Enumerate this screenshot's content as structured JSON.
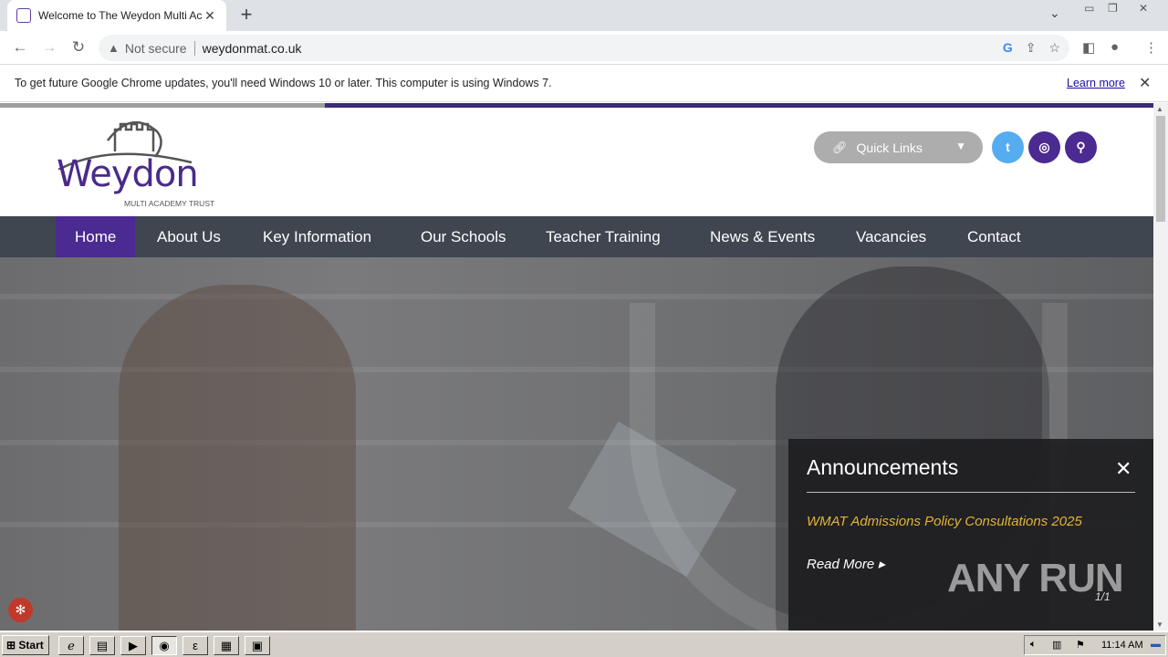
{
  "browser": {
    "tab_title": "Welcome to The Weydon Multi Acad",
    "tab_close": "✕",
    "new_tab": "+",
    "not_secure": "Not secure",
    "url": "weydonmat.co.uk",
    "infobar_message": "To get future Google Chrome updates, you'll need Windows 10 or later. This computer is using Windows 7.",
    "infobar_link": "Learn more"
  },
  "site": {
    "logo_name": "Weydon",
    "logo_sub": "MULTI ACADEMY TRUST",
    "quick_links": "Quick Links",
    "nav": [
      {
        "label": "Home"
      },
      {
        "label": "About Us"
      },
      {
        "label": "Key Information"
      },
      {
        "label": "Our Schools"
      },
      {
        "label": "Teacher Training"
      },
      {
        "label": "News & Events"
      },
      {
        "label": "Vacancies"
      },
      {
        "label": "Contact"
      }
    ],
    "announcements": {
      "title": "Announcements",
      "item": "WMAT Admissions Policy Consultations 2025",
      "read_more": "Read More",
      "pager": "1/1"
    },
    "watermark_text": "ANY RUN"
  },
  "colors": {
    "brand_purple": "#4b2a91",
    "nav_bg": "#3f4650",
    "twitter": "#55acee",
    "announce_item": "#e2b338"
  },
  "taskbar": {
    "start": "Start",
    "clock": "11:14 AM"
  }
}
